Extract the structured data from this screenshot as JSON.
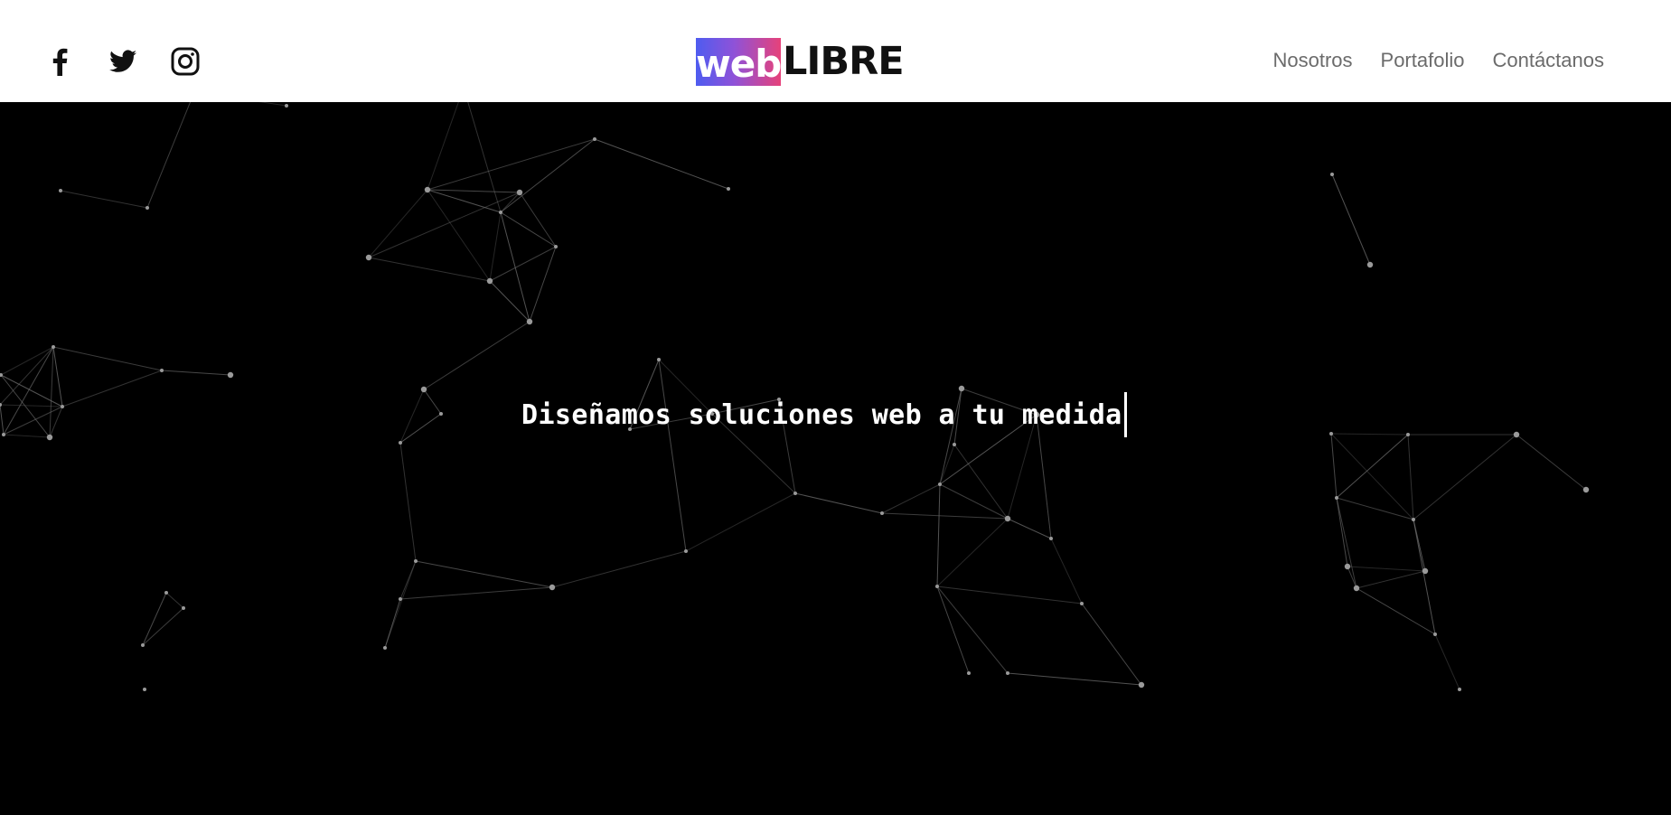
{
  "header": {
    "social": [
      {
        "name": "facebook-icon"
      },
      {
        "name": "twitter-icon"
      },
      {
        "name": "instagram-icon"
      }
    ],
    "logo": {
      "part1": "web",
      "part2": "LIBRE",
      "gradient": [
        "#4e5cf0",
        "#e6427a"
      ]
    },
    "nav": [
      "Nosotros",
      "Portafolio",
      "Contáctanos"
    ]
  },
  "hero": {
    "headline": "Diseñamos soluciones web a tu medida",
    "background": "#000000",
    "network_color": "#8a8a8a"
  }
}
